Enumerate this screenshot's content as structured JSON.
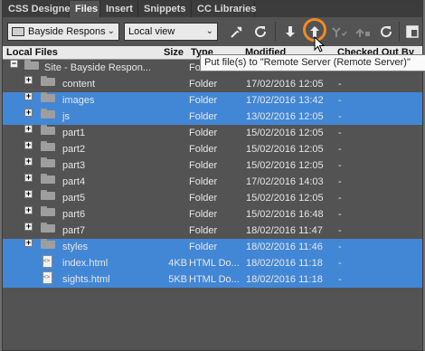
{
  "tabs": [
    {
      "label": "CSS Designer",
      "active": false
    },
    {
      "label": "Files",
      "active": true
    },
    {
      "label": "Insert",
      "active": false
    },
    {
      "label": "Snippets",
      "active": false
    },
    {
      "label": "CC Libraries",
      "active": false
    }
  ],
  "toolbar": {
    "site_select": "Bayside Respons",
    "view_select": "Local view",
    "icons": [
      "computer-icon",
      "connect-icon",
      "refresh-icon",
      "get-down-arrow-icon",
      "put-up-arrow-icon",
      "check-out-icon",
      "check-in-icon",
      "sync-icon",
      "expand-panel-icon"
    ]
  },
  "columns": {
    "local_files": "Local Files",
    "size": "Size",
    "type": "Type",
    "modified": "Modified",
    "checked_out": "Checked Out By"
  },
  "tooltip": "Put file(s) to \"Remote Server (Remote Server)\"",
  "files": [
    {
      "name": "Site - Bayside Respon...",
      "size": "",
      "type": "Folder",
      "modified": "",
      "checked": "",
      "kind": "site",
      "selected": false
    },
    {
      "name": "content",
      "size": "",
      "type": "Folder",
      "modified": "17/02/2016 12:05",
      "checked": "-",
      "kind": "folder",
      "selected": false
    },
    {
      "name": "images",
      "size": "",
      "type": "Folder",
      "modified": "17/02/2016 13:42",
      "checked": "-",
      "kind": "folder",
      "selected": true
    },
    {
      "name": "js",
      "size": "",
      "type": "Folder",
      "modified": "13/02/2016 12:05",
      "checked": "-",
      "kind": "folder",
      "selected": true
    },
    {
      "name": "part1",
      "size": "",
      "type": "Folder",
      "modified": "15/02/2016 12:05",
      "checked": "-",
      "kind": "folder",
      "selected": false
    },
    {
      "name": "part2",
      "size": "",
      "type": "Folder",
      "modified": "15/02/2016 12:05",
      "checked": "-",
      "kind": "folder",
      "selected": false
    },
    {
      "name": "part3",
      "size": "",
      "type": "Folder",
      "modified": "15/02/2016 12:05",
      "checked": "-",
      "kind": "folder",
      "selected": false
    },
    {
      "name": "part4",
      "size": "",
      "type": "Folder",
      "modified": "17/02/2016 14:03",
      "checked": "-",
      "kind": "folder",
      "selected": false
    },
    {
      "name": "part5",
      "size": "",
      "type": "Folder",
      "modified": "15/02/2016 12:05",
      "checked": "-",
      "kind": "folder",
      "selected": false
    },
    {
      "name": "part6",
      "size": "",
      "type": "Folder",
      "modified": "15/02/2016 16:48",
      "checked": "-",
      "kind": "folder",
      "selected": false
    },
    {
      "name": "part7",
      "size": "",
      "type": "Folder",
      "modified": "18/02/2016 11:47",
      "checked": "-",
      "kind": "folder",
      "selected": false
    },
    {
      "name": "styles",
      "size": "",
      "type": "Folder",
      "modified": "18/02/2016 11:46",
      "checked": "-",
      "kind": "folder",
      "selected": true
    },
    {
      "name": "index.html",
      "size": "4KB",
      "type": "HTML Do...",
      "modified": "18/02/2016 11:18",
      "checked": "-",
      "kind": "file",
      "selected": true
    },
    {
      "name": "sights.html",
      "size": "5KB",
      "type": "HTML Do...",
      "modified": "18/02/2016 11:18",
      "checked": "-",
      "kind": "file",
      "selected": true
    }
  ],
  "colors": {
    "selection": "#4287d6",
    "highlight_ring": "#f08a24",
    "panel": "#535353"
  }
}
